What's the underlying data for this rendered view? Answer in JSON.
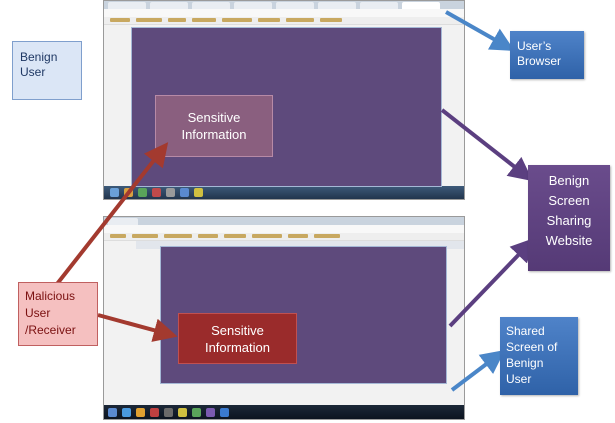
{
  "labels": {
    "benign_user": "Benign User",
    "users_browser": "User’s Browser",
    "benign_website": "Benign Screen Sharing Website",
    "malicious_user": "Malicious User /Receiver",
    "shared_screen": "Shared Screen of Benign User",
    "sensitive_top": "Sensitive Information",
    "sensitive_bottom": "Sensitive Information"
  },
  "colors": {
    "screen": "#5e4a7c",
    "purple_arrow": "#5b3f80",
    "red_arrow": "#a33a2f",
    "blue_arrow": "#4a86c8"
  }
}
